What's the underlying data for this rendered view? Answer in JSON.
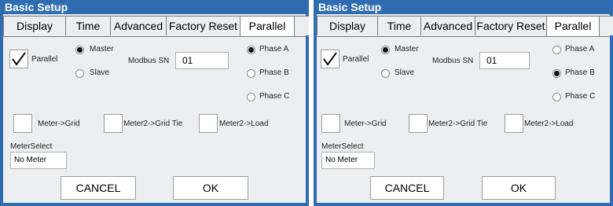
{
  "window": {
    "title": "Basic Setup"
  },
  "tabs": [
    "Display",
    "Time",
    "Advanced",
    "Factory Reset",
    "Parallel"
  ],
  "parallel": {
    "label": "Parallel",
    "checked": true
  },
  "role": {
    "master": "Master",
    "slave": "Slave"
  },
  "modbus": {
    "label": "Modbus SN",
    "value": "01"
  },
  "phase": {
    "a": "Phase A",
    "b": "Phase B",
    "c": "Phase C"
  },
  "checks": {
    "meter_grid": "Meter->Grid",
    "meter2_grid_tie": "Meter2->Grid Tie",
    "meter2_load": "Meter2->Load"
  },
  "meter_select": {
    "label": "MeterSelect",
    "value": "No Meter"
  },
  "buttons": {
    "cancel": "CANCEL",
    "ok": "OK"
  },
  "panels": [
    {
      "selected_role": "Master",
      "selected_phase": "Phase A"
    },
    {
      "selected_role": "Master",
      "selected_phase": "Phase B"
    }
  ],
  "colors": {
    "titlebar": "#2f6db1",
    "background": "#eceef0"
  }
}
